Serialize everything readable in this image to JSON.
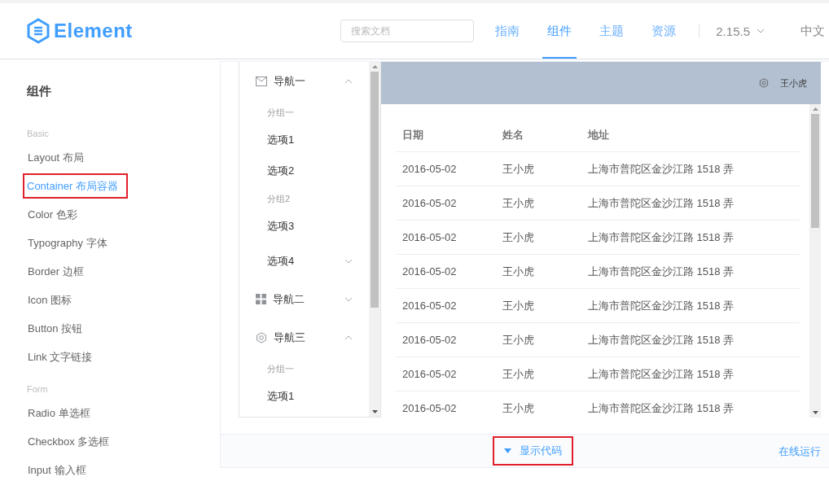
{
  "header": {
    "logo": "Element",
    "search": {
      "placeholder": "搜索文档"
    },
    "nav": [
      {
        "label": "指南",
        "selected": false
      },
      {
        "label": "组件",
        "selected": true
      },
      {
        "label": "主题",
        "selected": false
      },
      {
        "label": "资源",
        "selected": false
      }
    ],
    "version": "2.15.5",
    "language": "中文"
  },
  "sidebar": {
    "title": "组件",
    "groups": [
      {
        "label": "Basic",
        "items": [
          {
            "label": "Layout 布局",
            "selected": false,
            "annotated": false
          },
          {
            "label": "Container 布局容器",
            "selected": true,
            "annotated": true
          },
          {
            "label": "Color 色彩",
            "selected": false,
            "annotated": false
          },
          {
            "label": "Typography 字体",
            "selected": false,
            "annotated": false
          },
          {
            "label": "Border 边框",
            "selected": false,
            "annotated": false
          },
          {
            "label": "Icon 图标",
            "selected": false,
            "annotated": false
          },
          {
            "label": "Button 按钮",
            "selected": false,
            "annotated": false
          },
          {
            "label": "Link 文字链接",
            "selected": false,
            "annotated": false
          }
        ]
      },
      {
        "label": "Form",
        "items": [
          {
            "label": "Radio 单选框",
            "selected": false,
            "annotated": false
          },
          {
            "label": "Checkbox 多选框",
            "selected": false,
            "annotated": false
          },
          {
            "label": "Input 输入框",
            "selected": false,
            "annotated": false
          }
        ]
      }
    ]
  },
  "demo": {
    "menu": [
      {
        "kind": "submenu",
        "label": "导航一",
        "expanded": true
      },
      {
        "kind": "group",
        "label": "分组一"
      },
      {
        "kind": "item",
        "label": "选项1"
      },
      {
        "kind": "item",
        "label": "选项2"
      },
      {
        "kind": "group",
        "label": "分组2"
      },
      {
        "kind": "item",
        "label": "选项3"
      },
      {
        "kind": "subitem",
        "label": "选项4",
        "expanded": false
      },
      {
        "kind": "submenu",
        "label": "导航二",
        "expanded": false
      },
      {
        "kind": "submenu",
        "label": "导航三",
        "expanded": true
      },
      {
        "kind": "group",
        "label": "分组一"
      },
      {
        "kind": "item",
        "label": "选项1"
      }
    ],
    "user": "王小虎",
    "table": {
      "columns": [
        "日期",
        "姓名",
        "地址"
      ],
      "rows": [
        [
          "2016-05-02",
          "王小虎",
          "上海市普陀区金沙江路 1518 弄"
        ],
        [
          "2016-05-02",
          "王小虎",
          "上海市普陀区金沙江路 1518 弄"
        ],
        [
          "2016-05-02",
          "王小虎",
          "上海市普陀区金沙江路 1518 弄"
        ],
        [
          "2016-05-02",
          "王小虎",
          "上海市普陀区金沙江路 1518 弄"
        ],
        [
          "2016-05-02",
          "王小虎",
          "上海市普陀区金沙江路 1518 弄"
        ],
        [
          "2016-05-02",
          "王小虎",
          "上海市普陀区金沙江路 1518 弄"
        ],
        [
          "2016-05-02",
          "王小虎",
          "上海市普陀区金沙江路 1518 弄"
        ],
        [
          "2016-05-02",
          "王小虎",
          "上海市普陀区金沙江路 1518 弄"
        ]
      ]
    },
    "show_code": {
      "label": "显示代码",
      "annotated": true
    },
    "run_online": "在线运行"
  }
}
